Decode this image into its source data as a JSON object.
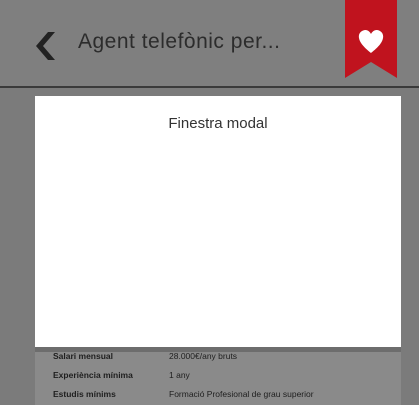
{
  "header": {
    "title": "Agent telefònic per...",
    "accent_color": "#c0131e",
    "back_icon": "chevron-left-icon",
    "favorite_icon": "heart-icon"
  },
  "modal": {
    "title": "Finestra modal"
  },
  "details": [
    {
      "label": "Salari mensual",
      "value": "28.000€/any bruts"
    },
    {
      "label": "Experiència mínima",
      "value": "1 any"
    },
    {
      "label": "Estudis mínims",
      "value": "Formació Profesional de grau superior"
    }
  ]
}
